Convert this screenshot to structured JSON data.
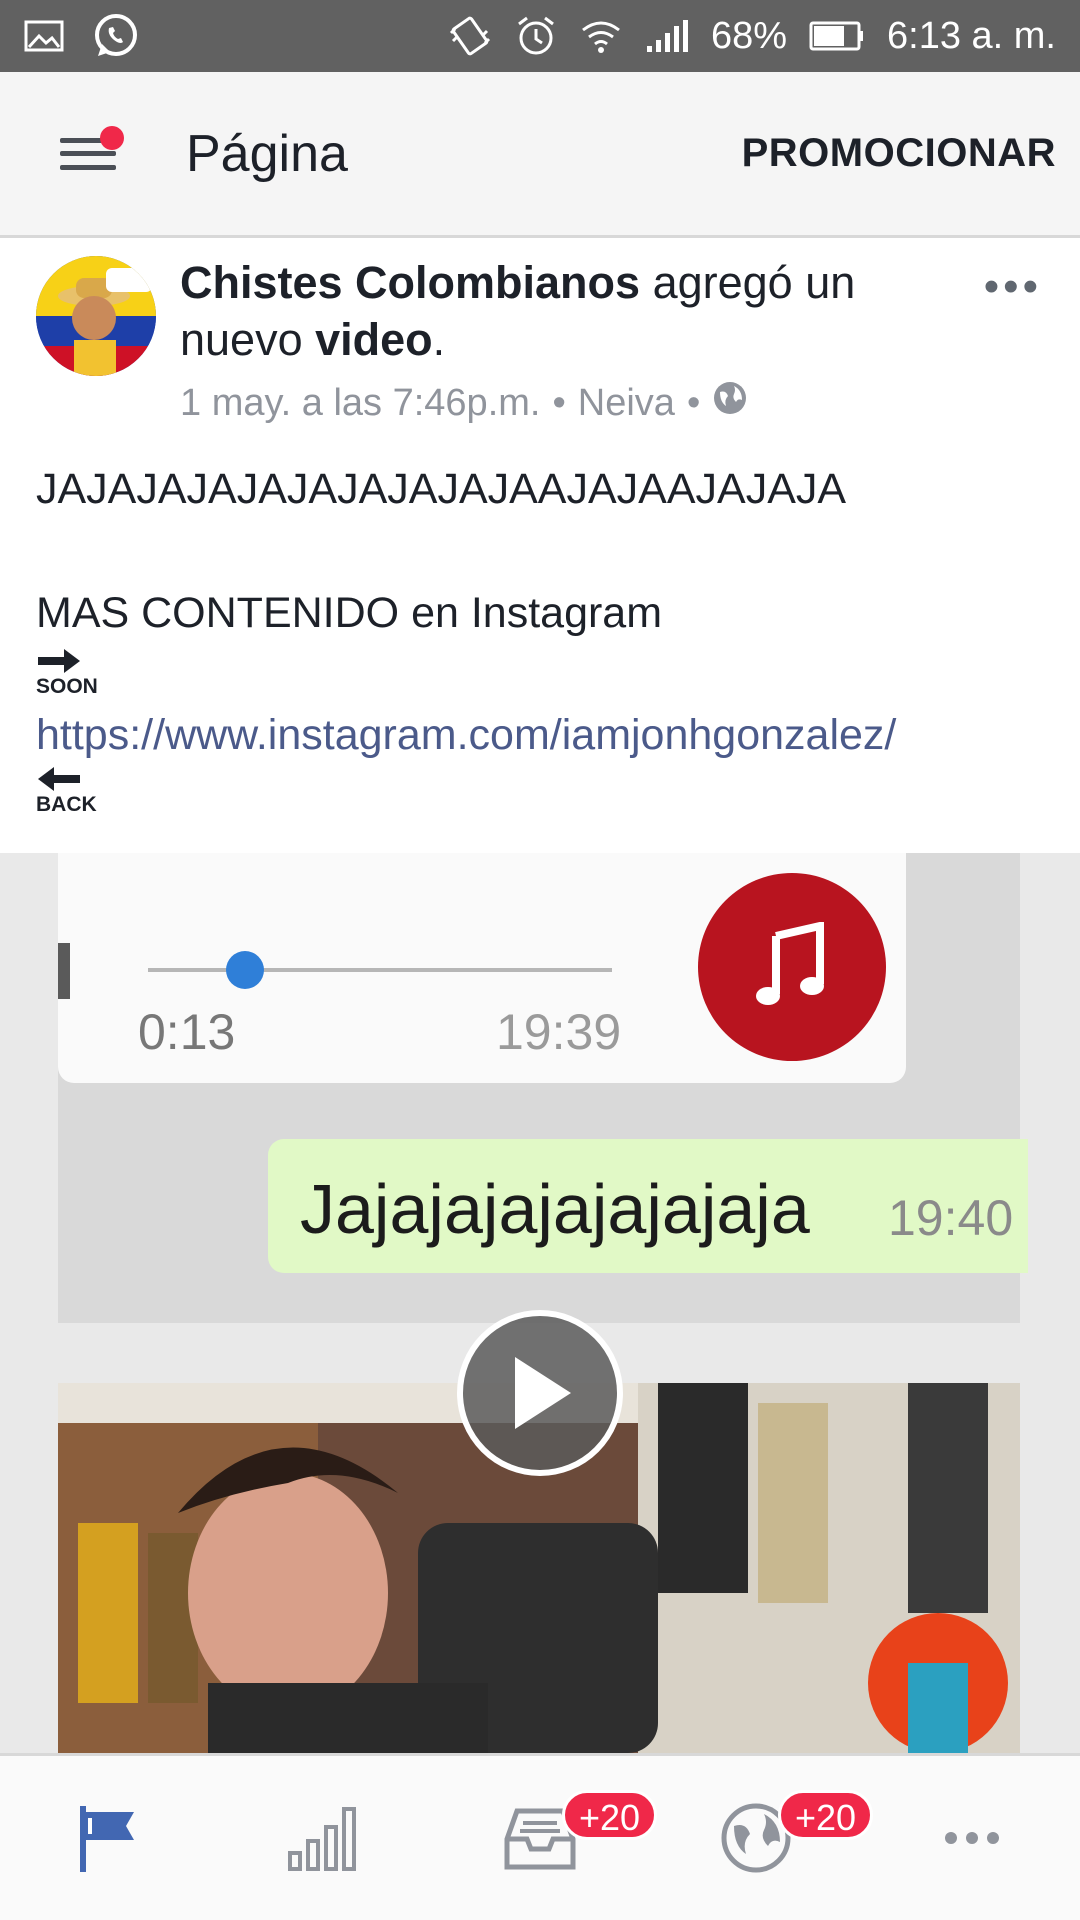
{
  "status_bar": {
    "battery_percent": "68%",
    "time": "6:13 a. m.",
    "icons": [
      "gallery-icon",
      "whatsapp-icon",
      "vibrate-icon",
      "alarm-icon",
      "wifi-icon",
      "signal-icon",
      "battery-icon"
    ]
  },
  "app_bar": {
    "title": "Página",
    "action": "PROMOCIONAR"
  },
  "post": {
    "author": "Chistes Colombianos",
    "verb": " agregó un nuevo ",
    "object": "video",
    "end": ".",
    "date": "1 may. a las 7:46p.m.",
    "separator": "•",
    "location": "Neiva",
    "more": "•••",
    "body": {
      "line1": "JAJAJAJAJAJAJAJAJAJAAJAJAAJAJAJA",
      "line2": "MAS CONTENIDO en Instagram",
      "soon_label": "SOON",
      "link": "https://www.instagram.com/iamjonhgonzalez/",
      "back_label": "BACK"
    }
  },
  "video": {
    "audio_current": "0:13",
    "audio_total": "19:39",
    "audio_progress": 0.21,
    "message_text": "Jajajajajajajajaja",
    "message_time": "19:40"
  },
  "bottom_nav": {
    "tabs": [
      {
        "name": "page",
        "icon": "flag-icon",
        "active": true
      },
      {
        "name": "insights",
        "icon": "bar-chart-icon"
      },
      {
        "name": "inbox",
        "icon": "inbox-icon",
        "badge": "+20"
      },
      {
        "name": "notifications",
        "icon": "globe-icon",
        "badge": "+20"
      },
      {
        "name": "more",
        "icon": "more-icon"
      }
    ]
  },
  "colors": {
    "accent": "#4267b2",
    "badge": "#f02849",
    "status_bar": "#616161"
  }
}
